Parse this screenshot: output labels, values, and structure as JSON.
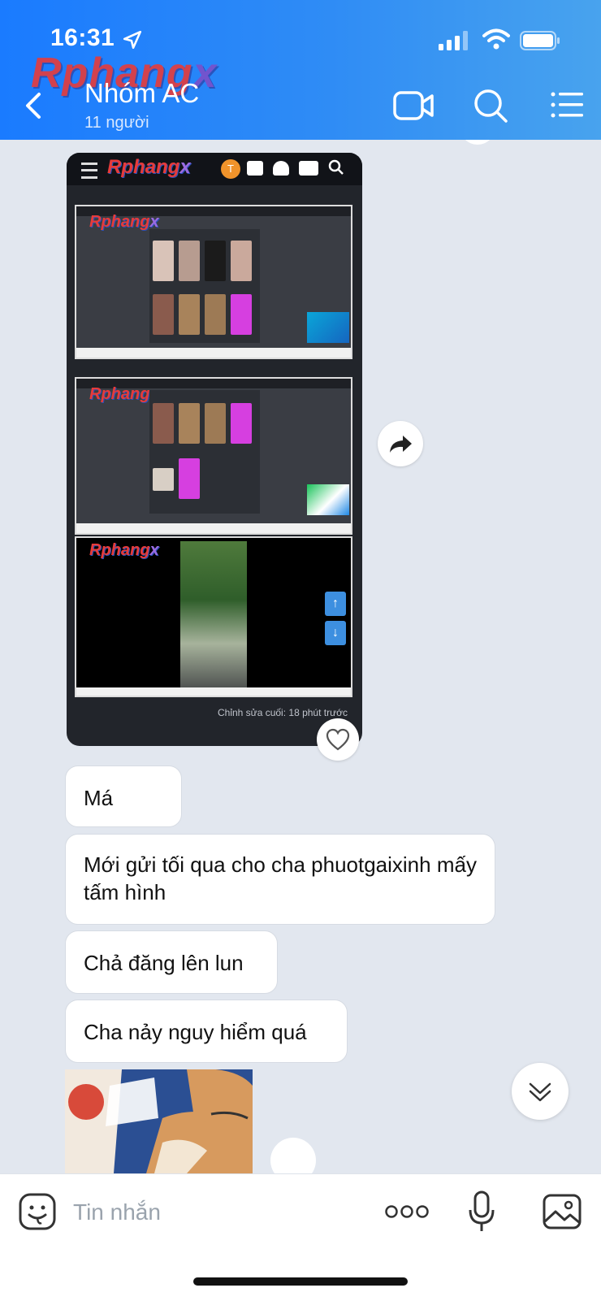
{
  "status": {
    "time": "16:31"
  },
  "header": {
    "title": "Nhóm AC",
    "subtitle": "11 người",
    "watermark": "Rphangx"
  },
  "image_message": {
    "edit_note": "Chỉnh sửa cuối: 18 phút trước",
    "avatar_letter": "T"
  },
  "messages": [
    {
      "text": "Má"
    },
    {
      "text": "Mới gửi tối qua cho cha phuotgaixinh mấy tấm hình"
    },
    {
      "text": "Chả đăng lên lun"
    },
    {
      "text": "Cha nảy nguy hiểm quá"
    }
  ],
  "input": {
    "placeholder": "Tin nhắn"
  },
  "colors": {
    "header": "#1a7bff",
    "chat_bg": "#e2e7ef",
    "bubble": "#ffffff"
  }
}
